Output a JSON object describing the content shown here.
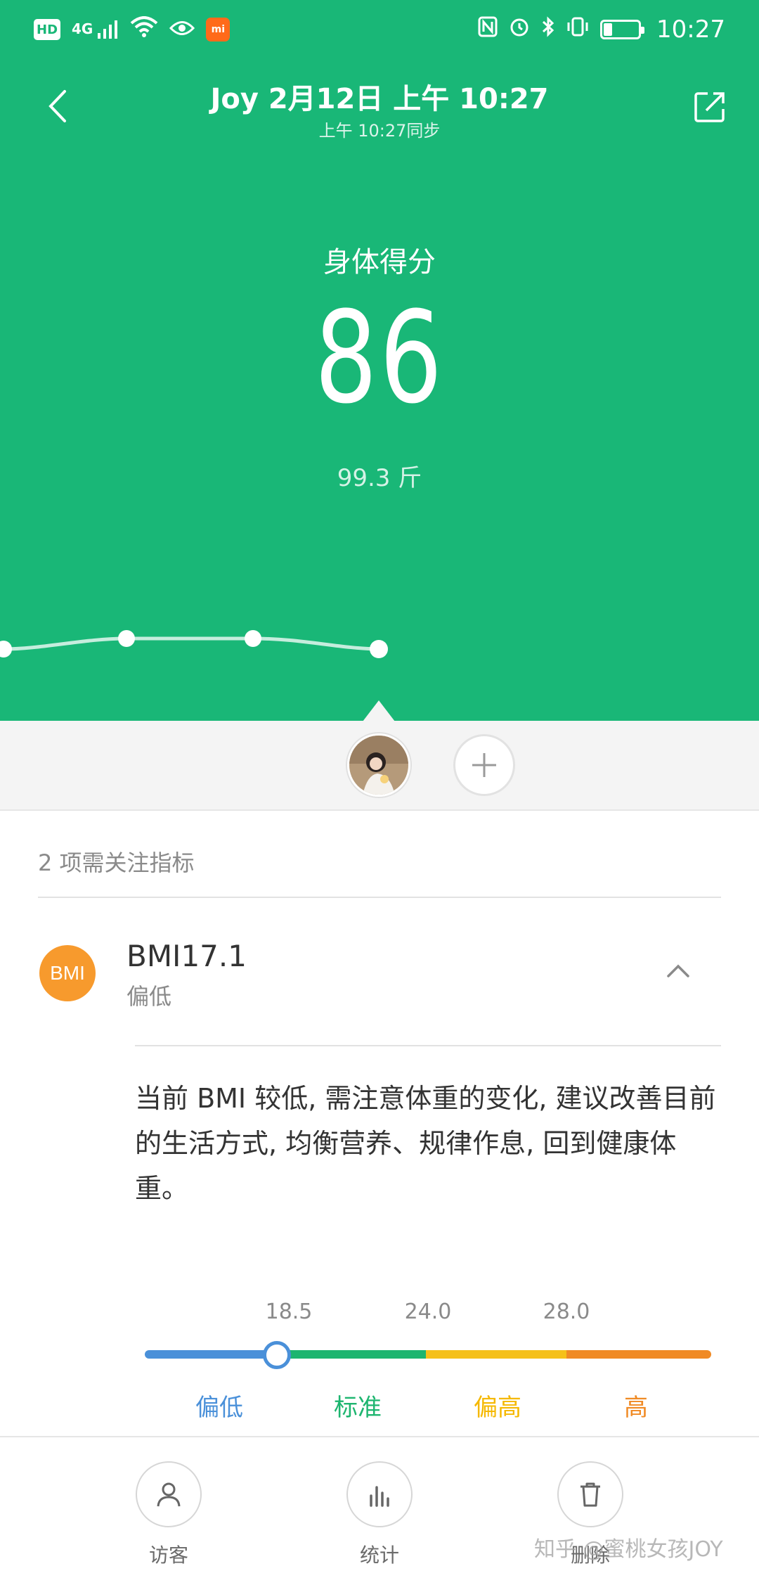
{
  "status_bar": {
    "left_icons": [
      "hd-icon",
      "signal-4g-icon",
      "wifi-icon",
      "eye-icon",
      "mi-app-icon"
    ],
    "hd_text": "HD",
    "network": "4G",
    "right_icons": [
      "nfc-icon",
      "alarm-icon",
      "bluetooth-icon",
      "vibrate-icon",
      "battery-icon"
    ],
    "time": "10:27",
    "battery_level": 0.25
  },
  "header": {
    "title": "Joy 2月12日 上午 10:27",
    "subtitle": "上午 10:27同步"
  },
  "score": {
    "label": "身体得分",
    "value": "86",
    "weight": "99.3 斤"
  },
  "colors": {
    "brand_green": "#19b777",
    "bmi_badge": "#f79a2d",
    "scale_low": "#4a90d9",
    "scale_normal": "#1db56f",
    "scale_high": "#f5c019",
    "scale_very_high": "#f08a24"
  },
  "attention": {
    "title": "2 项需关注指标"
  },
  "bmi": {
    "badge": "BMI",
    "name": "BMI17.1",
    "value": 17.1,
    "status": "偏低",
    "description": "当前 BMI 较低, 需注意体重的变化, 建议改善目前的生活方式, 均衡营养、规律作息, 回到健康体重。",
    "ticks": [
      "18.5",
      "24.0",
      "28.0"
    ],
    "ranges": [
      "偏低",
      "标准",
      "偏高",
      "高"
    ]
  },
  "bottom_tabs": [
    {
      "label": "访客",
      "icon": "person-icon"
    },
    {
      "label": "统计",
      "icon": "bar-chart-icon"
    },
    {
      "label": "删除",
      "icon": "trash-icon"
    }
  ],
  "watermark": "知乎 @蜜桃女孩JOY"
}
